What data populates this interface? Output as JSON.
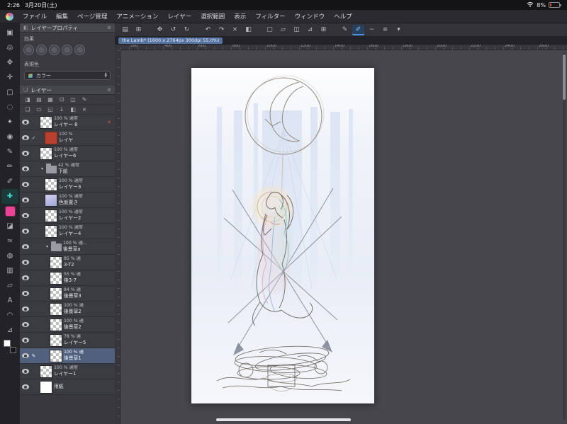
{
  "status_bar": {
    "time": "2:26",
    "date": "3月20日(土)",
    "battery_percent": "8%"
  },
  "menu_bar": {
    "items": [
      "ファイル",
      "編集",
      "ページ管理",
      "アニメーション",
      "レイヤー",
      "選択範囲",
      "表示",
      "フィルター",
      "ウィンドウ",
      "ヘルプ"
    ]
  },
  "toolbar": {
    "icons": [
      {
        "name": "layer-panel-toggle-icon",
        "glyph": "▤"
      },
      {
        "name": "navigator-icon",
        "glyph": "⊞"
      },
      {
        "name": "separator",
        "sep": true
      },
      {
        "name": "transform-icon",
        "glyph": "✥"
      },
      {
        "name": "rotate-left-icon",
        "glyph": "↺"
      },
      {
        "name": "rotate-right-icon",
        "glyph": "↻"
      },
      {
        "name": "separator",
        "sep": true
      },
      {
        "name": "undo-icon",
        "glyph": "↶"
      },
      {
        "name": "redo-icon",
        "glyph": "↷"
      },
      {
        "name": "clear-icon",
        "glyph": "×"
      },
      {
        "name": "fill-icon",
        "glyph": "◧"
      },
      {
        "name": "separator",
        "sep": true
      },
      {
        "name": "select-all-icon",
        "glyph": "▢"
      },
      {
        "name": "deselect-icon",
        "glyph": "▱"
      },
      {
        "name": "invert-selection-icon",
        "glyph": "◫"
      },
      {
        "name": "snap-to-ruler-icon",
        "glyph": "⊿"
      },
      {
        "name": "snap-to-grid-icon",
        "glyph": "⊞"
      },
      {
        "name": "separator",
        "sep": true
      },
      {
        "name": "brush-tip-icon",
        "glyph": "✎"
      },
      {
        "name": "brush-mode-icon",
        "glyph": "✐",
        "selected": true
      },
      {
        "name": "line-correction-icon",
        "glyph": "~"
      },
      {
        "name": "toolbar-settings-icon",
        "glyph": "≡"
      },
      {
        "name": "more-icon",
        "glyph": "▾"
      }
    ]
  },
  "document_tab": {
    "title": "the Lamb* (1600 x 2764px 300dpi 55.0%)"
  },
  "tool_strip": {
    "tools": [
      {
        "name": "operation-tool",
        "glyph": "▣"
      },
      {
        "name": "zoom-tool",
        "glyph": "◎"
      },
      {
        "name": "hand-tool",
        "glyph": "✥"
      },
      {
        "name": "move-tool",
        "glyph": "✛"
      },
      {
        "name": "selection-area-tool",
        "glyph": "▢"
      },
      {
        "name": "lasso-tool",
        "glyph": "◌"
      },
      {
        "name": "auto-select-tool",
        "glyph": "✦"
      },
      {
        "name": "eyedropper-tool",
        "glyph": "◉"
      },
      {
        "name": "pen-tool",
        "glyph": "✎"
      },
      {
        "name": "pencil-tool",
        "glyph": "✏"
      },
      {
        "name": "brush-tool",
        "glyph": "✐"
      },
      {
        "name": "layer-move-tool",
        "glyph": "✚",
        "variant": "selected"
      },
      {
        "name": "main-color-swatch",
        "variant": "pink"
      },
      {
        "name": "eraser-tool",
        "glyph": "◪"
      },
      {
        "name": "blend-tool",
        "glyph": "≈"
      },
      {
        "name": "fill-tool",
        "glyph": "◍"
      },
      {
        "name": "gradient-tool",
        "glyph": "▥"
      },
      {
        "name": "figure-tool",
        "glyph": "▱"
      },
      {
        "name": "text-tool",
        "glyph": "A"
      },
      {
        "name": "balloon-tool",
        "glyph": "◠"
      },
      {
        "name": "ruler-tool",
        "glyph": "⊿"
      },
      {
        "name": "color-chips",
        "variant": "chips"
      }
    ]
  },
  "layer_property": {
    "title": "レイヤープロパティ",
    "effect_label": "効果",
    "effect_icons": [
      {
        "name": "border-effect-icon"
      },
      {
        "name": "tone-effect-icon"
      },
      {
        "name": "layer-color-effect-icon"
      },
      {
        "name": "extract-line-effect-icon"
      },
      {
        "name": "effect-settings-icon"
      }
    ],
    "expression_label": "表現色",
    "expression_value": "カラー"
  },
  "layers_panel": {
    "title": "レイヤー",
    "header_icons_row1": [
      {
        "name": "blend-mode-icon",
        "glyph": "◨"
      },
      {
        "name": "opacity-icon",
        "glyph": "▤"
      },
      {
        "name": "protect-alpha-icon",
        "glyph": "▦"
      },
      {
        "name": "lock-layer-icon",
        "glyph": "⊡"
      },
      {
        "name": "lock-transparent-icon",
        "glyph": "◫"
      },
      {
        "name": "draft-layer-icon",
        "glyph": "✎"
      }
    ],
    "header_icons_row2": [
      {
        "name": "new-layer-icon",
        "glyph": "❏"
      },
      {
        "name": "new-folder-icon",
        "glyph": "▭"
      },
      {
        "name": "duplicate-layer-icon",
        "glyph": "◱"
      },
      {
        "name": "merge-down-icon",
        "glyph": "↓"
      },
      {
        "name": "layer-mask-icon",
        "glyph": "◧"
      },
      {
        "name": "delete-layer-icon",
        "glyph": "×"
      }
    ],
    "layers": [
      {
        "opacity": "100 %",
        "mode": "通常",
        "name": "レイヤー 8",
        "indent": 0,
        "thumb": "checker",
        "mark": "✕"
      },
      {
        "opacity": "100 %",
        "mode": "",
        "name": "レイヤ",
        "indent": 1,
        "thumb": "red",
        "check": true
      },
      {
        "opacity": "100 %",
        "mode": "通常",
        "name": "レイヤー6",
        "indent": 0,
        "thumb": "checker"
      },
      {
        "opacity": "42 %",
        "mode": "通常",
        "name": "下絵",
        "indent": 0,
        "type": "folder"
      },
      {
        "opacity": "100 %",
        "mode": "通常",
        "name": "レイヤー3",
        "indent": 1,
        "thumb": "checker"
      },
      {
        "opacity": "100 %",
        "mode": "通常",
        "name": "色仮置き",
        "indent": 1,
        "thumb": "purple"
      },
      {
        "opacity": "100 %",
        "mode": "通常",
        "name": "レイヤー2",
        "indent": 1,
        "thumb": "checker"
      },
      {
        "opacity": "100 %",
        "mode": "通常",
        "name": "レイヤー4",
        "indent": 1,
        "thumb": "checker"
      },
      {
        "opacity": "100 %",
        "mode": "通...",
        "name": "後景草a",
        "indent": 1,
        "type": "folder"
      },
      {
        "opacity": "85 %",
        "mode": "通",
        "name": "3-T2",
        "indent": 2,
        "thumb": "checker"
      },
      {
        "opacity": "55 %",
        "mode": "通",
        "name": "後3-7",
        "indent": 2,
        "thumb": "checker"
      },
      {
        "opacity": "84 %",
        "mode": "通",
        "name": "後景草3",
        "indent": 2,
        "thumb": "checker"
      },
      {
        "opacity": "100 %",
        "mode": "通",
        "name": "後景草2",
        "indent": 2,
        "thumb": "checker"
      },
      {
        "opacity": "100 %",
        "mode": "通",
        "name": "後景草2",
        "indent": 2,
        "thumb": "checker"
      },
      {
        "opacity": "78 %",
        "mode": "通",
        "name": "レイヤー5",
        "indent": 2,
        "thumb": "checker"
      },
      {
        "opacity": "100 %",
        "mode": "通",
        "name": "後景草1",
        "indent": 2,
        "thumb": "checker",
        "selected": true
      },
      {
        "opacity": "100 %",
        "mode": "通常",
        "name": "レイヤー1",
        "indent": 0,
        "thumb": "checker"
      },
      {
        "opacity": "",
        "mode": "",
        "name": "用紙",
        "indent": 0,
        "thumb": "white",
        "type": "paper"
      }
    ]
  },
  "ruler": {
    "h_labels": [
      "200",
      "400",
      "600",
      "800",
      "1000",
      "1200",
      "1400",
      "1600",
      "1800",
      "2000",
      "2200",
      "2400",
      "2600"
    ]
  }
}
